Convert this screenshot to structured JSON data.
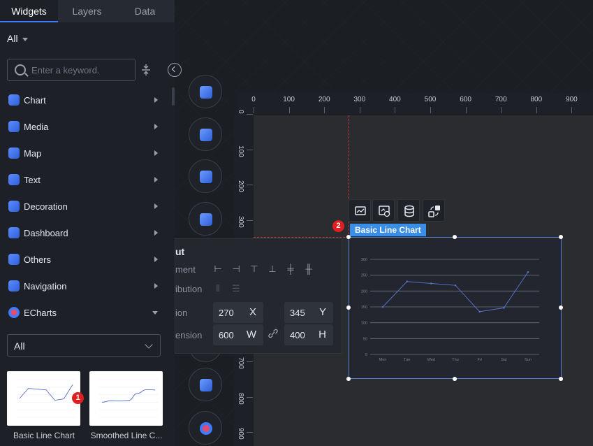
{
  "tabs": [
    {
      "label": "Widgets",
      "active": true
    },
    {
      "label": "Layers",
      "active": false
    },
    {
      "label": "Data",
      "active": false
    }
  ],
  "filter": {
    "label": "All"
  },
  "search": {
    "placeholder": "Enter a keyword."
  },
  "categories": [
    {
      "label": "Chart",
      "icon": "chart-icon",
      "expanded": false
    },
    {
      "label": "Media",
      "icon": "media-icon",
      "expanded": false
    },
    {
      "label": "Map",
      "icon": "map-icon",
      "expanded": false
    },
    {
      "label": "Text",
      "icon": "text-icon",
      "expanded": false
    },
    {
      "label": "Decoration",
      "icon": "decoration-icon",
      "expanded": false
    },
    {
      "label": "Dashboard",
      "icon": "dashboard-icon",
      "expanded": false
    },
    {
      "label": "Others",
      "icon": "others-icon",
      "expanded": false
    },
    {
      "label": "Navigation",
      "icon": "navigation-icon",
      "expanded": false
    },
    {
      "label": "ECharts",
      "icon": "echarts-icon",
      "expanded": true
    }
  ],
  "echarts_filter": {
    "value": "All"
  },
  "widget_cards": [
    {
      "label": "Basic Line Chart",
      "badge": "1"
    },
    {
      "label": "Smoothed Line C..."
    }
  ],
  "ruler": {
    "x_ticks": [
      "0",
      "100",
      "200",
      "300",
      "400",
      "500",
      "600",
      "700",
      "800",
      "900"
    ],
    "y_ticks": [
      "0",
      "100",
      "200",
      "300",
      "700",
      "800",
      "900"
    ]
  },
  "layout_panel": {
    "title": "ut",
    "alignment_label": "ment",
    "distribution_label": "ibution",
    "position_label": "ion",
    "dimension_label": "ension",
    "x": {
      "value": "270",
      "unit": "X"
    },
    "y": {
      "value": "345",
      "unit": "Y"
    },
    "w": {
      "value": "600",
      "unit": "W"
    },
    "h": {
      "value": "400",
      "unit": "H"
    }
  },
  "selected_widget": {
    "tag": "Basic Line Chart",
    "badge": "2"
  },
  "chart_data": {
    "type": "line",
    "categories": [
      "Mon",
      "Tue",
      "Wed",
      "Thu",
      "Fri",
      "Sat",
      "Sun"
    ],
    "series": [
      {
        "values": [
          150,
          230,
          224,
          218,
          135,
          147,
          260
        ]
      }
    ],
    "ylim": [
      0,
      300
    ],
    "y_ticks": [
      "0",
      "50",
      "100",
      "150",
      "200",
      "250",
      "300"
    ],
    "grid": true,
    "colors": {
      "line": "#5470c6",
      "grid": "#6b7080",
      "text": "#7d8390"
    }
  },
  "thumbnail_data": {
    "basic": [
      150,
      230,
      224,
      218,
      135,
      147,
      260
    ],
    "smoothed": [
      120,
      132,
      130,
      134,
      190,
      220,
      218
    ]
  }
}
